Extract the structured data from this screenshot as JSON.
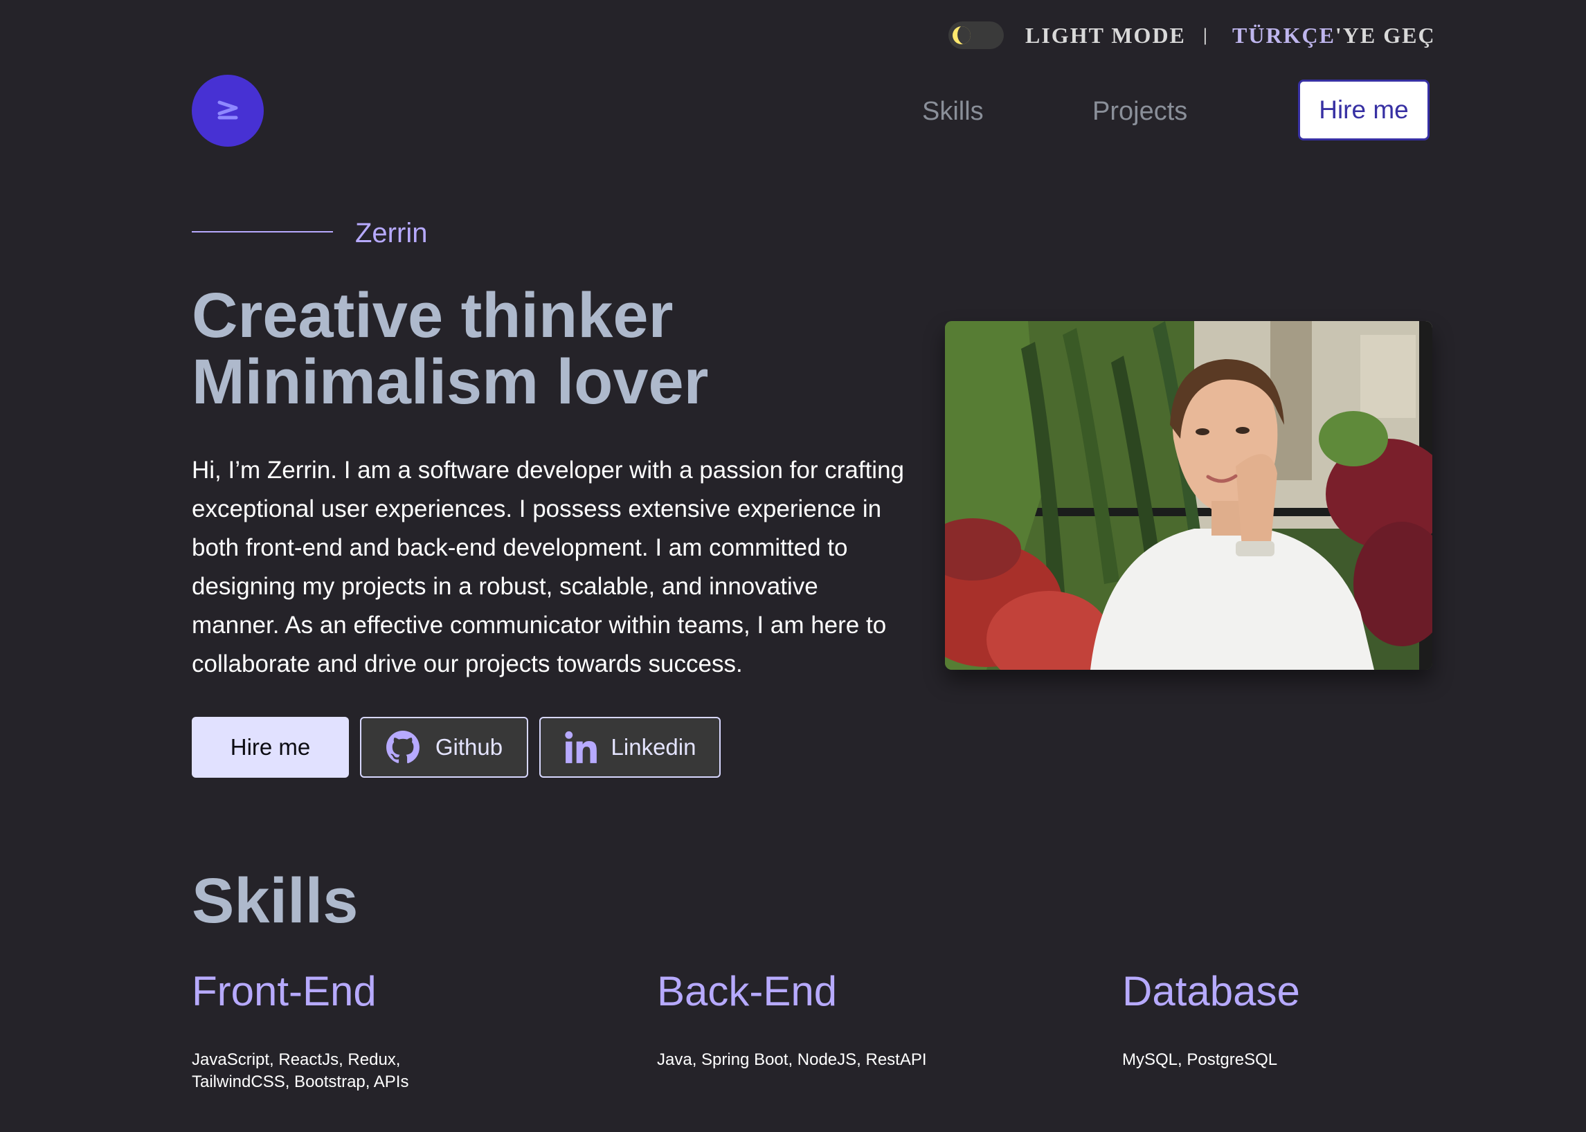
{
  "topbar": {
    "mode_label": "LIGHT MODE",
    "separator": "|",
    "lang_highlight": "TÜRKÇE",
    "lang_rest": "'YE GEÇ"
  },
  "nav": {
    "logo_text": "Z",
    "links": [
      "Skills",
      "Projects"
    ],
    "hire_label": "Hire me"
  },
  "hero": {
    "name": "Zerrin",
    "headline_line1": "Creative thinker",
    "headline_line2": "Minimalism lover",
    "intro": "Hi, I’m Zerrin. I am a software developer with a passion for crafting exceptional user experiences. I possess extensive experience in both front-end and back-end development. I am committed to designing my projects in a robust, scalable, and innovative manner. As an effective communicator within teams, I am here to collaborate and drive our projects towards success.",
    "buttons": {
      "hire": "Hire me",
      "github": "Github",
      "linkedin": "Linkedin"
    }
  },
  "skills": {
    "title": "Skills",
    "columns": [
      {
        "heading": "Front-End",
        "items": "JavaScript, ReactJs, Redux, TailwindCSS, Bootstrap, APIs"
      },
      {
        "heading": "Back-End",
        "items": "Java, Spring Boot, NodeJS, RestAPI"
      },
      {
        "heading": "Database",
        "items": "MySQL, PostgreSQL"
      }
    ]
  },
  "colors": {
    "background": "#252329",
    "accent": "#b7aaff",
    "logo": "#4731d3",
    "heading": "#aeb9cc"
  },
  "icons": [
    "moon-icon",
    "github-icon",
    "linkedin-icon"
  ]
}
